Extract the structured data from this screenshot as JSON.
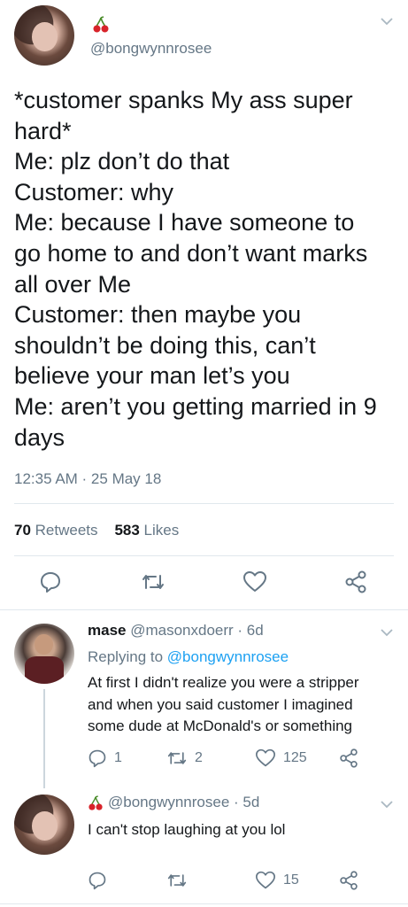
{
  "main_tweet": {
    "handle": "@bongwynnrosee",
    "lines": [
      "*customer spanks My ass super",
      "hard*",
      "Me: plz don’t do that",
      "Customer: why",
      "Me: because I have someone to",
      "go home to and don’t want marks",
      "all over Me",
      "Customer: then maybe you",
      "shouldn’t be doing this, can’t",
      "believe your man let’s you",
      "Me: aren’t you getting married in 9",
      "days"
    ],
    "timestamp": "12:35 AM · 25 May 18",
    "retweets_count": "70",
    "retweets_label": "Retweets",
    "likes_count": "583",
    "likes_label": "Likes"
  },
  "reply1": {
    "name": "mase",
    "handle": "@masonxdoerr",
    "time": "· 6d",
    "replying_label": "Replying to",
    "replying_handle": "@bongwynnrosee",
    "lines": [
      "At first I didn't realize you were a stripper",
      "and when you said customer I imagined",
      "some dude at McDonald's or something"
    ],
    "reply_count": "1",
    "retweet_count": "2",
    "like_count": "125"
  },
  "reply2": {
    "handle": "@bongwynnrosee",
    "time": "· 5d",
    "text": "I can't stop laughing at you lol",
    "like_count": "15"
  },
  "colors": {
    "text": "#14171a",
    "secondary": "#657786",
    "link": "#1da1f2",
    "divider": "#e1e8ed"
  },
  "icons": [
    "cherry-icon",
    "chevron-down-icon",
    "reply-icon",
    "retweet-icon",
    "like-icon",
    "share-icon"
  ]
}
